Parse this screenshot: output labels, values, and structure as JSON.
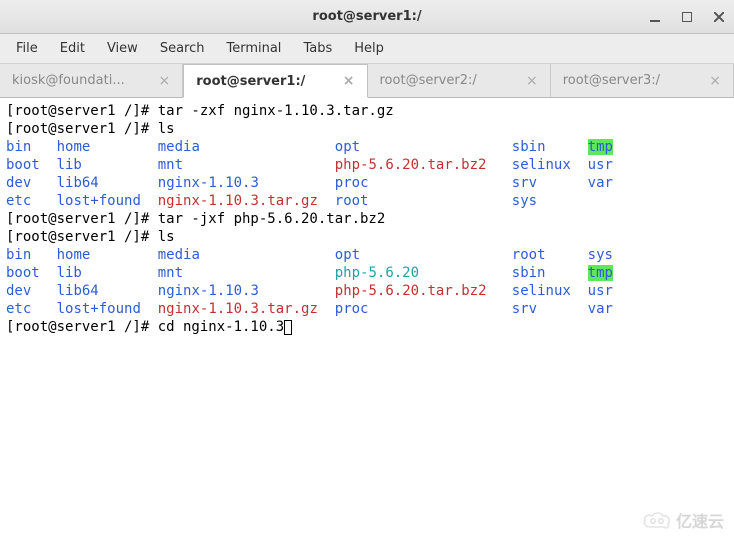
{
  "window": {
    "title": "root@server1:/"
  },
  "menu": {
    "file": "File",
    "edit": "Edit",
    "view": "View",
    "search": "Search",
    "terminal": "Terminal",
    "tabs": "Tabs",
    "help": "Help"
  },
  "tabs": {
    "t0": {
      "label": "kiosk@foundati..."
    },
    "t1": {
      "label": "root@server1:/"
    },
    "t2": {
      "label": "root@server2:/"
    },
    "t3": {
      "label": "root@server3:/"
    }
  },
  "term": {
    "p1": "[root@server1 /]# ",
    "c1": "tar -zxf nginx-1.10.3.tar.gz",
    "p2": "[root@server1 /]# ",
    "c2": "ls",
    "ls1": {
      "r0": {
        "a": "bin",
        "b": "home",
        "c": "media",
        "d": "opt",
        "e": "sbin",
        "f": "tmp"
      },
      "r1": {
        "a": "boot",
        "b": "lib",
        "c": "mnt",
        "d": "php-5.6.20.tar.bz2",
        "e": "selinux",
        "f": "usr"
      },
      "r2": {
        "a": "dev",
        "b": "lib64",
        "c": "nginx-1.10.3",
        "d": "proc",
        "e": "srv",
        "f": "var"
      },
      "r3": {
        "a": "etc",
        "b": "lost+found",
        "c": "nginx-1.10.3.tar.gz",
        "d": "root",
        "e": "sys",
        "f": ""
      }
    },
    "p3": "[root@server1 /]# ",
    "c3": "tar -jxf php-5.6.20.tar.bz2",
    "p4": "[root@server1 /]# ",
    "c4": "ls",
    "ls2": {
      "r0": {
        "a": "bin",
        "b": "home",
        "c": "media",
        "d": "opt",
        "e": "root",
        "f": "sys"
      },
      "r1": {
        "a": "boot",
        "b": "lib",
        "c": "mnt",
        "d": "php-5.6.20",
        "e": "sbin",
        "f": "tmp"
      },
      "r2": {
        "a": "dev",
        "b": "lib64",
        "c": "nginx-1.10.3",
        "d": "php-5.6.20.tar.bz2",
        "e": "selinux",
        "f": "usr"
      },
      "r3": {
        "a": "etc",
        "b": "lost+found",
        "c": "nginx-1.10.3.tar.gz",
        "d": "proc",
        "e": "srv",
        "f": "var"
      }
    },
    "p5": "[root@server1 /]# ",
    "c5": "cd nginx-1.10.3"
  },
  "watermark": {
    "text": "亿速云"
  }
}
